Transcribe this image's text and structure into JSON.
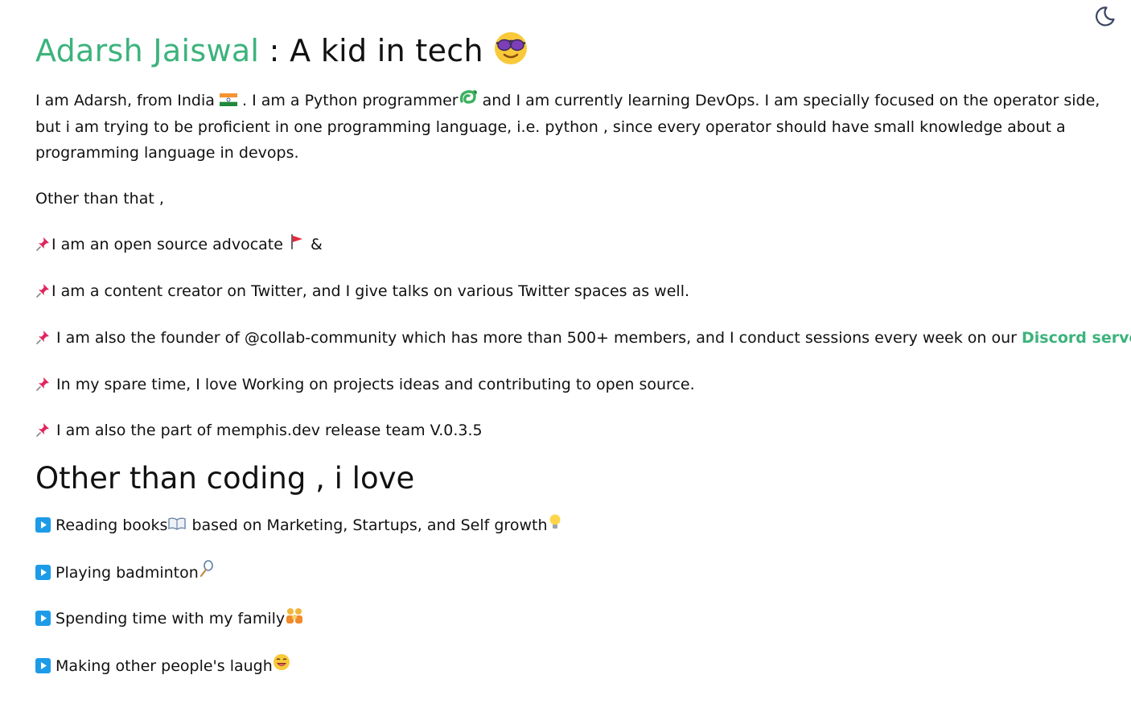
{
  "header": {
    "name_link": "Adarsh Jaiswal",
    "title_rest": " : A kid in tech ",
    "title_emoji": "smiling-face-with-sunglasses-icon",
    "theme_toggle_icon": "moon-icon"
  },
  "intro": {
    "part1": "I am Adarsh, from India ",
    "part2": " . I am a Python programmer",
    "part3": " and I am currently learning DevOps. I am specially focused on the operator side, but i am trying to be proficient in one programming language, i.e. python , since every operator should have small knowledge about a programming language in devops."
  },
  "other_than_that": "Other than that ,",
  "facts": {
    "f1_text": "I am an open source advocate ",
    "f1_suffix": " &",
    "f2_text": "I am a content creator on Twitter, and I give talks on various Twitter spaces as well.",
    "f3_text": " I am also the founder of @collab-community which has more than 500+ members, and I conduct sessions every week on our ",
    "f3_link": "Discord server",
    "f3_end": ".",
    "f4_text": " In my spare time, I love Working on projects ideas and contributing to open source.",
    "f5_text": " I am also the part of memphis.dev release team V.0.3.5"
  },
  "hobbies": {
    "heading": "Other than coding , i love",
    "h1_text": " Reading books",
    "h1_mid": " based on Marketing, Startups, and Self growth",
    "h2_text": " Playing badminton",
    "h3_text": " Spending time with my family",
    "h4_text": " Making other people's laugh"
  },
  "colors": {
    "accent": "#3cb37c",
    "text": "#111111",
    "play_button": "#1e9be8",
    "pin": "#e0245e"
  }
}
